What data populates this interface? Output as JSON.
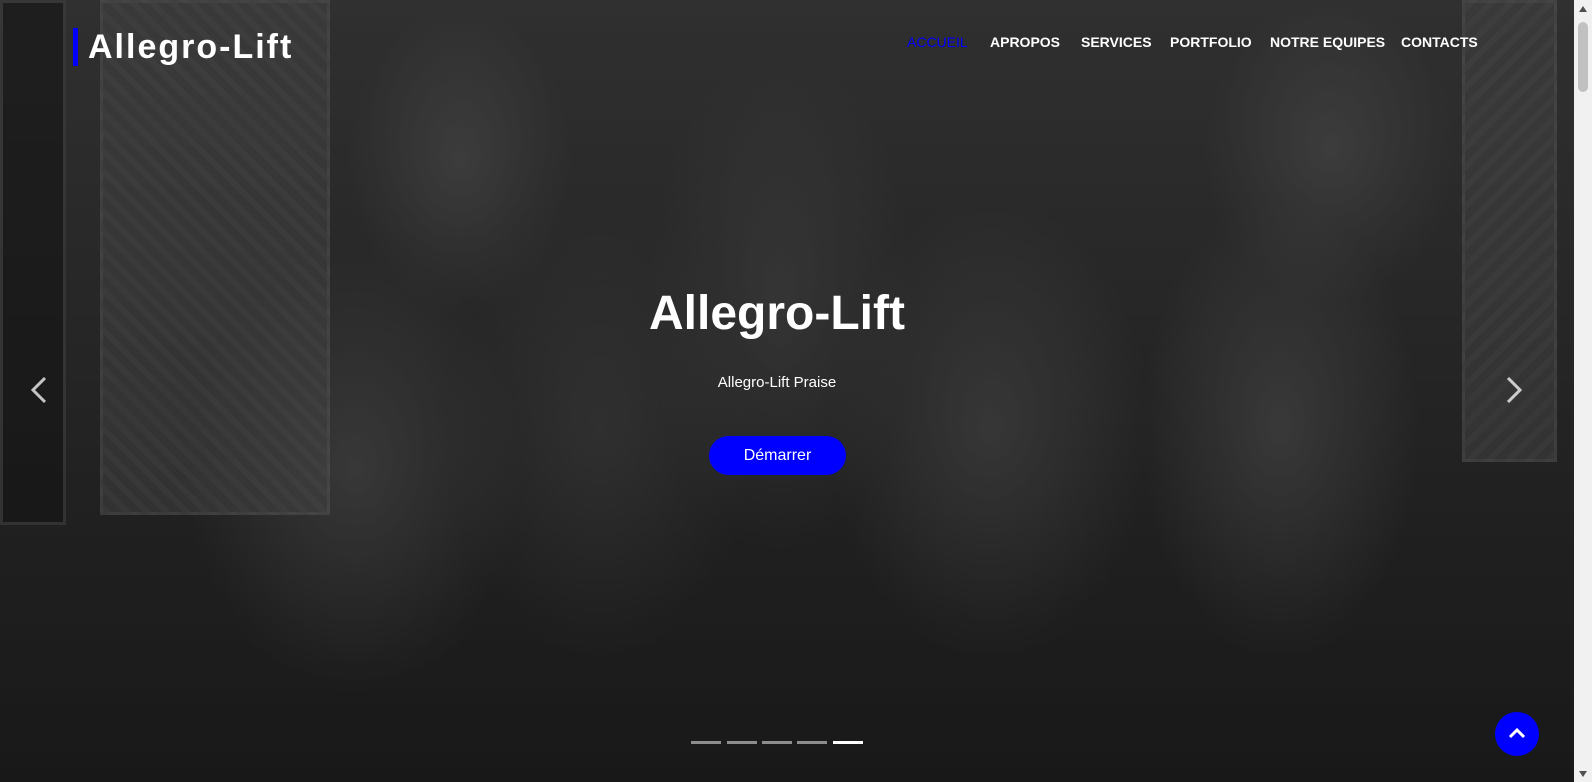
{
  "header": {
    "brand": "Allegro-Lift",
    "accent_color": "#0000ff",
    "nav": [
      {
        "label": "ACCUEIL",
        "active": true
      },
      {
        "label": "APROPOS",
        "active": false
      },
      {
        "label": "SERVICES",
        "active": false
      },
      {
        "label": "PORTFOLIO",
        "active": false
      },
      {
        "label": "NOTRE EQUIPES",
        "active": false
      },
      {
        "label": "CONTACTS",
        "active": false
      }
    ]
  },
  "hero": {
    "title": "Allegro-Lift",
    "subtitle": "Allegro-Lift Praise",
    "cta_label": "Démarrer",
    "prev_icon": "chevron-left-icon",
    "next_icon": "chevron-right-icon",
    "slide_count": 5,
    "active_slide": 5
  },
  "back_to_top": {
    "icon": "chevron-up-icon",
    "color": "#0000ff"
  }
}
